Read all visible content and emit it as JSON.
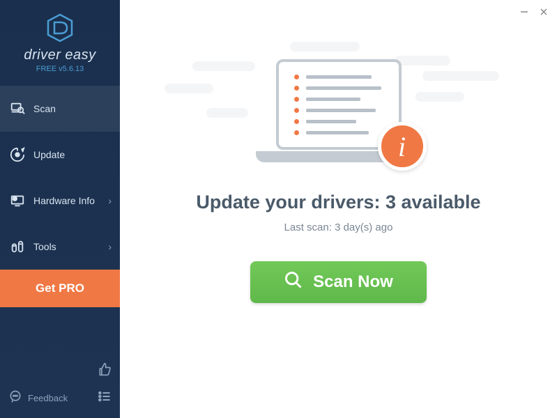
{
  "brand": {
    "name": "driver easy",
    "version": "FREE v5.6.13"
  },
  "sidebar": {
    "items": [
      {
        "label": "Scan",
        "icon": "scan"
      },
      {
        "label": "Update",
        "icon": "update"
      },
      {
        "label": "Hardware Info",
        "icon": "hardware",
        "chevron": true
      },
      {
        "label": "Tools",
        "icon": "tools",
        "chevron": true
      }
    ],
    "get_pro_label": "Get PRO",
    "feedback_label": "Feedback"
  },
  "main": {
    "title": "Update your drivers: 3 available",
    "subtitle": "Last scan: 3 day(s) ago",
    "scan_button_label": "Scan Now"
  }
}
